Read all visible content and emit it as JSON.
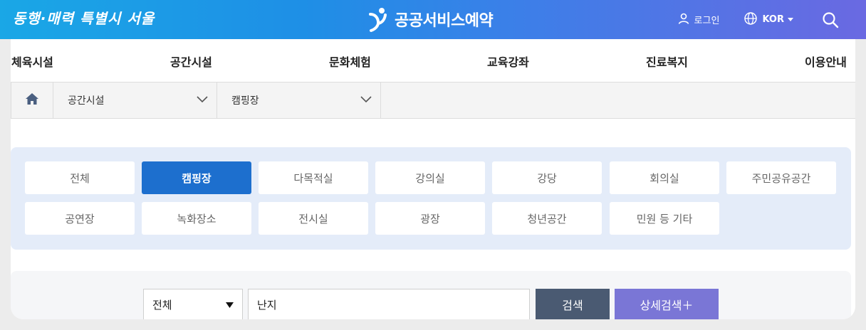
{
  "header": {
    "slogan": "동행·매력 특별시 서울",
    "brand": "공공서비스예약",
    "login_label": "로그인",
    "language_label": "KOR",
    "icons": [
      "user-icon",
      "globe-icon",
      "caret-down-icon",
      "search-icon"
    ]
  },
  "nav": {
    "items": [
      {
        "label": "체육시설"
      },
      {
        "label": "공간시설"
      },
      {
        "label": "문화체험"
      },
      {
        "label": "교육강좌"
      },
      {
        "label": "진료복지"
      },
      {
        "label": "이용안내"
      }
    ]
  },
  "breadcrumb": {
    "home_icon": "home-icon",
    "level1": "공간시설",
    "level2": "캠핑장"
  },
  "categories": {
    "active_color": "#1d6fce",
    "items": [
      {
        "label": "전체"
      },
      {
        "label": "캠핑장",
        "active": true
      },
      {
        "label": "다목적실"
      },
      {
        "label": "강의실"
      },
      {
        "label": "강당"
      },
      {
        "label": "회의실"
      },
      {
        "label": "주민공유공간"
      },
      {
        "label": "공연장"
      },
      {
        "label": "녹화장소"
      },
      {
        "label": "전시실"
      },
      {
        "label": "광장"
      },
      {
        "label": "청년공간"
      },
      {
        "label": "민원 등 기타"
      }
    ]
  },
  "search": {
    "select_value": "전체",
    "input_value": "난지",
    "search_label": "검색",
    "detail_label": "상세검색＋"
  }
}
